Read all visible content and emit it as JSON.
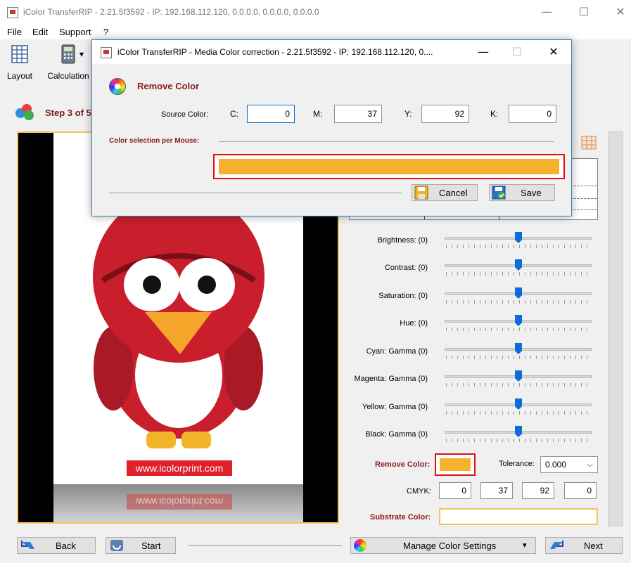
{
  "window": {
    "title": "iColor TransferRIP - 2.21.5f3592 - IP: 192.168.112.120, 0.0.0.0, 0.0.0.0, 0.0.0.0",
    "minimize": "—",
    "maximize": "☐",
    "close": "✕"
  },
  "menu": [
    "File",
    "Edit",
    "Support",
    "?"
  ],
  "toolbar": {
    "layout_label": "Layout",
    "calculation_label": "Calculation",
    "dropdown_glyph": "▾"
  },
  "step": {
    "label": "Step 3 of 5"
  },
  "preview": {
    "url_text": "www.icolorprint.com"
  },
  "adjustments": [
    {
      "label": "Brightness: (0)",
      "level": 0.5
    },
    {
      "label": "Contrast: (0)",
      "level": 0.5
    },
    {
      "label": "Saturation: (0)",
      "level": 0.5
    },
    {
      "label": "Hue: (0)",
      "level": 0.5
    },
    {
      "label": "Cyan: Gamma  (0)",
      "level": 0.5
    },
    {
      "label": "Magenta: Gamma  (0)",
      "level": 0.5
    },
    {
      "label": "Yellow: Gamma  (0)",
      "level": 0.5
    },
    {
      "label": "Black: Gamma  (0)",
      "level": 0.5
    }
  ],
  "remove_color": {
    "label": "Remove Color:",
    "swatch_color": "#f6b22f",
    "tolerance_label": "Tolerance:",
    "tolerance_value": "0.000",
    "chevron": "⌵"
  },
  "cmyk": {
    "label": "CMYK:",
    "values": [
      "0",
      "37",
      "92",
      "0"
    ]
  },
  "substrate": {
    "label": "Substrate Color:"
  },
  "bottom": {
    "back_label": "Back",
    "start_label": "Start",
    "manage_label": "Manage Color Settings",
    "manage_chevron": "▾",
    "next_label": "Next"
  },
  "dialog": {
    "title": "iColor TransferRIP - Media Color correction - 2.21.5f3592 - IP: 192.168.112.120, 0....",
    "minimize": "—",
    "maximize": "☐",
    "close": "✕",
    "heading": "Remove Color",
    "source_label": "Source Color:",
    "c_label": "C:",
    "m_label": "M:",
    "y_label": "Y:",
    "k_label": "K:",
    "c_value": "0",
    "m_value": "37",
    "y_value": "92",
    "k_value": "0",
    "selection_label": "Color selection per Mouse:",
    "picked_color": "#f6b22f",
    "cancel_label": "Cancel",
    "save_label": "Save"
  },
  "colors": {
    "accent_red": "#8b1a1a",
    "highlight_border": "#e0101a",
    "picked_orange": "#f6b22f",
    "preview_border": "#f6c25a"
  }
}
